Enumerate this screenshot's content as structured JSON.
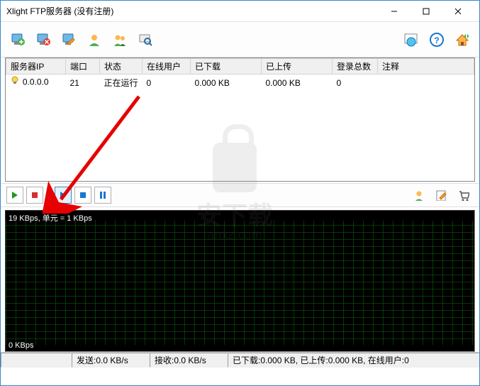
{
  "window": {
    "title": "Xlight FTP服务器 (没有注册)"
  },
  "table": {
    "columns": [
      "服务器IP",
      "端口",
      "状态",
      "在线用户",
      "已下载",
      "已上传",
      "登录总数",
      "注释"
    ],
    "rows": [
      {
        "ip": "0.0.0.0",
        "port": "21",
        "status": "正在运行",
        "online": "0",
        "downloaded": "0.000 KB",
        "uploaded": "0.000 KB",
        "logins": "0",
        "note": ""
      }
    ]
  },
  "graph": {
    "scale_label": "19 KBps, 单元 = 1 KBps",
    "zero_label": "0 KBps"
  },
  "status": {
    "send": "发送:0.0 KB/s",
    "recv": "接收:0.0 KB/s",
    "summary": "已下载:0.000 KB, 已上传:0.000 KB, 在线用户:0"
  },
  "watermark": {
    "line1": "安下载",
    "line2": "anxz.com"
  }
}
